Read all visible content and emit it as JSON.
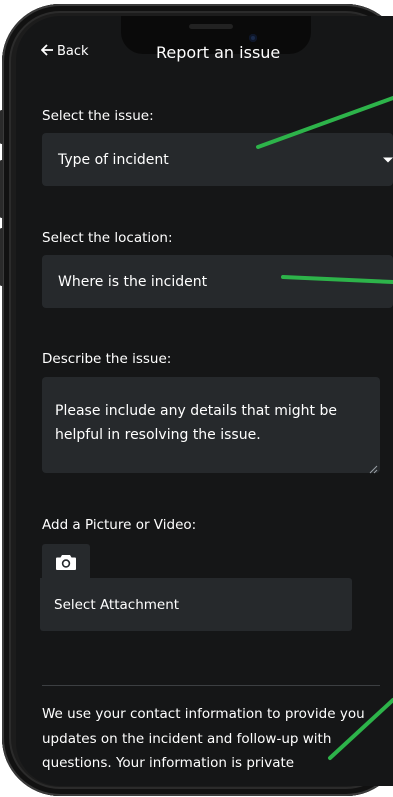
{
  "nav": {
    "back_label": "Back",
    "title": "Report an issue"
  },
  "issue": {
    "label": "Select the issue:",
    "value": "Type of incident"
  },
  "location": {
    "label": "Select the location:",
    "value": "Where is the incident"
  },
  "description": {
    "label": "Describe the issue:",
    "placeholder": "Please include any details that might be helpful in resolving the issue."
  },
  "attachment": {
    "label": "Add a Picture or Video:",
    "button_label": "Select Attachment"
  },
  "privacy": {
    "text": "We use your contact information to provide you updates on the incident and follow-up with questions. Your information is private"
  },
  "colors": {
    "screen_bg": "#151617",
    "field_bg": "#26292c",
    "text": "#ffffff",
    "annotation_line": "#2db34a"
  },
  "icons": {
    "back": "arrow-left-icon",
    "camera": "camera-icon",
    "dropdown": "caret-down-icon",
    "resize": "resize-grip-icon"
  }
}
